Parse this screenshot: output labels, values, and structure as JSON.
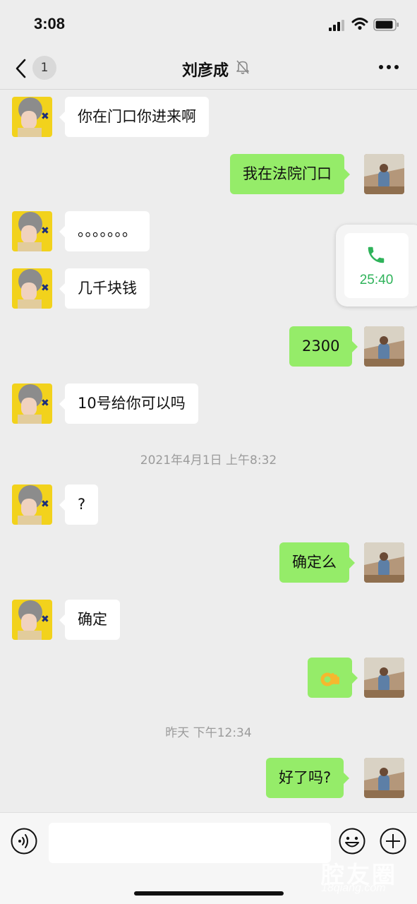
{
  "status_bar": {
    "time": "3:08"
  },
  "nav": {
    "unread_count": "1",
    "title": "刘彦成"
  },
  "messages": [
    {
      "side": "left",
      "text": "你在门口你进来啊"
    },
    {
      "side": "right",
      "text": "我在法院门口"
    },
    {
      "side": "left",
      "text": "。。。。。。。"
    },
    {
      "side": "left",
      "text": "几千块钱"
    },
    {
      "side": "right",
      "text": "2300"
    },
    {
      "side": "left",
      "text": "10号给你可以吗"
    },
    {
      "side": "left",
      "text": "?"
    },
    {
      "side": "right",
      "text": "确定么"
    },
    {
      "side": "left",
      "text": "确定"
    },
    {
      "side": "right",
      "emoji": "ok-hand"
    },
    {
      "side": "right",
      "text": "好了吗?"
    }
  ],
  "timestamps": [
    "2021年4月1日 上午8:32",
    "昨天 下午12:34"
  ],
  "call_widget": {
    "duration": "25:40",
    "icon": "phone-icon"
  },
  "input": {
    "placeholder": ""
  },
  "watermark": {
    "brand": "腔友圈",
    "url": "18qiang.com"
  },
  "colors": {
    "accent_green": "#95ec69",
    "call_green": "#2fb35a",
    "background": "#ededed"
  }
}
